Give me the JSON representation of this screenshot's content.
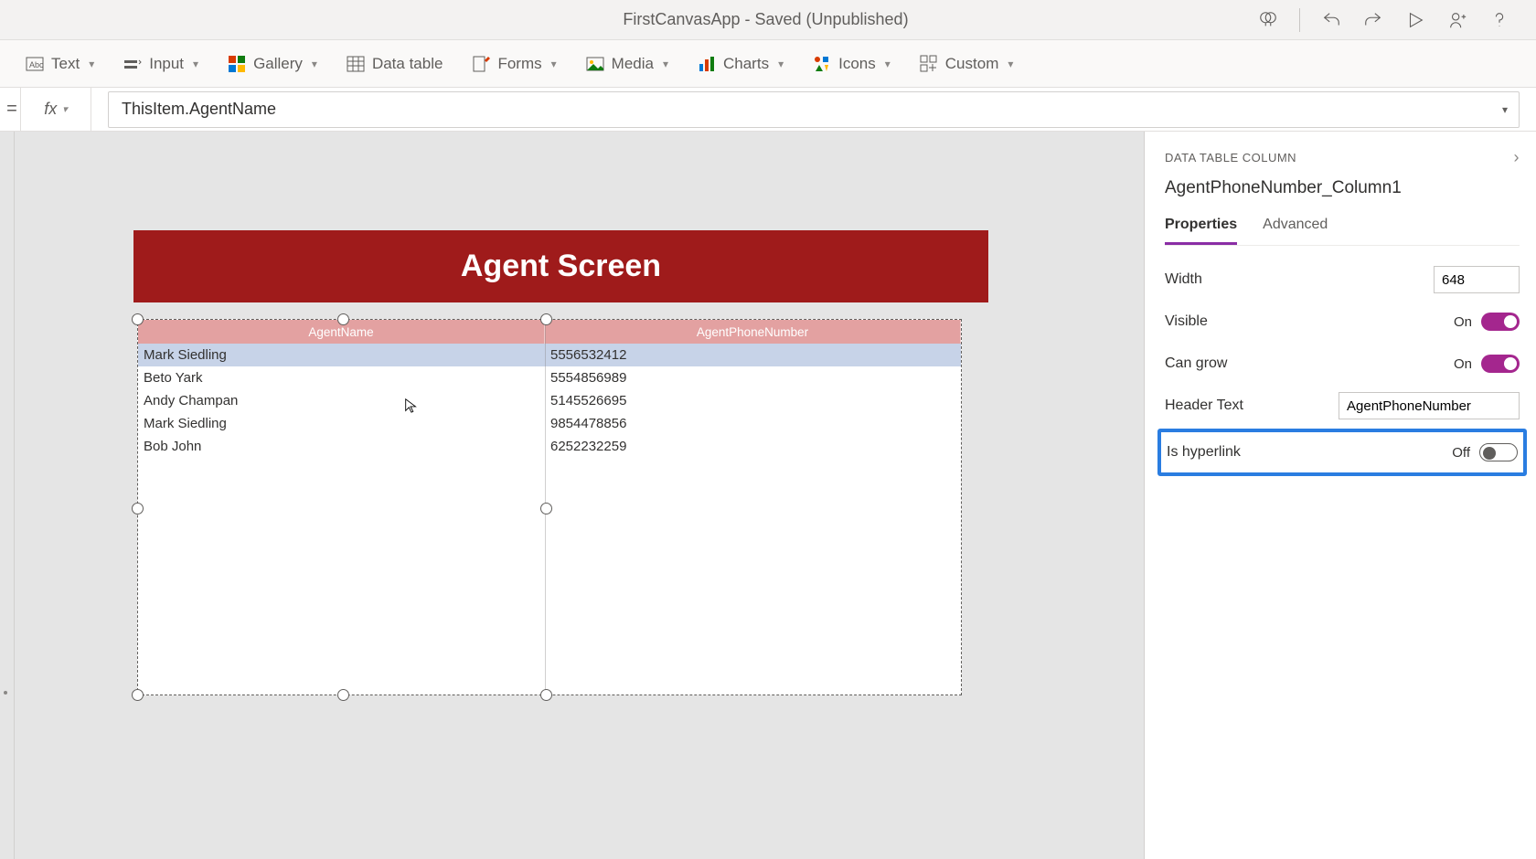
{
  "title": "FirstCanvasApp - Saved (Unpublished)",
  "ribbon": {
    "text": "Text",
    "input": "Input",
    "gallery": "Gallery",
    "datatable": "Data table",
    "forms": "Forms",
    "media": "Media",
    "charts": "Charts",
    "icons": "Icons",
    "custom": "Custom"
  },
  "formula": {
    "fx": "fx",
    "value": "ThisItem.AgentName"
  },
  "screen": {
    "title": "Agent Screen",
    "columns": {
      "c1": "AgentName",
      "c2": "AgentPhoneNumber"
    },
    "rows": [
      {
        "name": "Mark Siedling",
        "phone": "5556532412"
      },
      {
        "name": "Beto Yark",
        "phone": "5554856989"
      },
      {
        "name": "Andy Champan",
        "phone": "5145526695"
      },
      {
        "name": "Mark Siedling",
        "phone": "9854478856"
      },
      {
        "name": "Bob John",
        "phone": "6252232259"
      }
    ]
  },
  "panel": {
    "breadcrumb": "DATA TABLE COLUMN",
    "name": "AgentPhoneNumber_Column1",
    "tabs": {
      "properties": "Properties",
      "advanced": "Advanced"
    },
    "props": {
      "width_label": "Width",
      "width_value": "648",
      "visible_label": "Visible",
      "visible_value": "On",
      "cangrow_label": "Can grow",
      "cangrow_value": "On",
      "headertext_label": "Header Text",
      "headertext_value": "AgentPhoneNumber",
      "ishyperlink_label": "Is hyperlink",
      "ishyperlink_value": "Off"
    }
  }
}
